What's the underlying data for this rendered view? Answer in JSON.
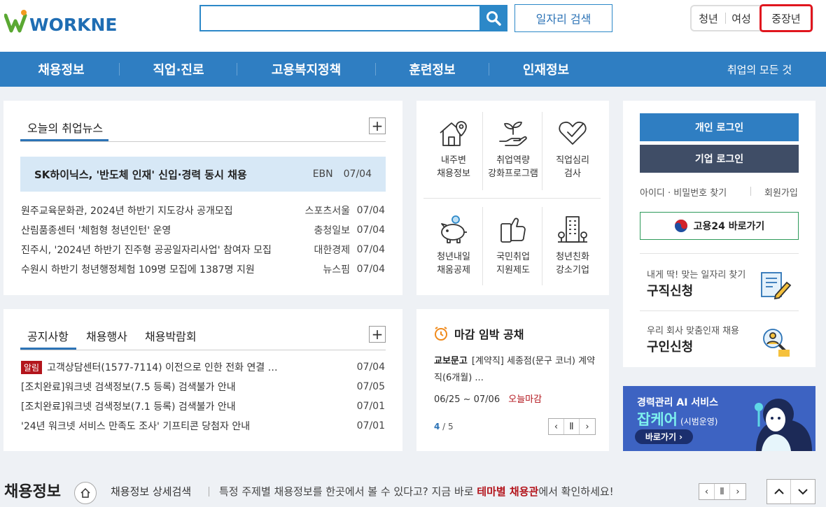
{
  "header": {
    "logo_text": "WORKNET",
    "search": {
      "value": "",
      "placeholder": ""
    },
    "job_search_label": "일자리 검색",
    "group_tabs": [
      "청년",
      "여성",
      "중장년"
    ]
  },
  "nav": {
    "items": [
      "채용정보",
      "직업·진로",
      "고용복지정책",
      "훈련정보",
      "인재정보"
    ],
    "all_label": "취업의 모든 것"
  },
  "news": {
    "tab": "오늘의 취업뉴스",
    "featured": {
      "title": "SK하이닉스, '반도체 인재' 신입·경력 동시 채용",
      "source": "EBN",
      "date": "07/04"
    },
    "items": [
      {
        "title": "원주교육문화관, 2024년 하반기 지도강사 공개모집",
        "source": "스포츠서울",
        "date": "07/04"
      },
      {
        "title": "산림품종센터 '체험형 청년인턴' 운영",
        "source": "충청일보",
        "date": "07/04"
      },
      {
        "title": "진주시, '2024년 하반기 진주형 공공일자리사업' 참여자 모집",
        "source": "대한경제",
        "date": "07/04"
      },
      {
        "title": "수원시 하반기 청년행정체험 109명 모집에 1387명 지원",
        "source": "뉴스핌",
        "date": "07/04"
      }
    ]
  },
  "services": [
    {
      "line1": "내주변",
      "line2": "채용정보",
      "icon": "house-location-icon"
    },
    {
      "line1": "취업역량",
      "line2": "강화프로그램",
      "icon": "hand-sprout-icon"
    },
    {
      "line1": "직업심리",
      "line2": "검사",
      "icon": "heart-check-icon"
    },
    {
      "line1": "청년내일",
      "line2": "채움공제",
      "icon": "piggy-bank-icon"
    },
    {
      "line1": "국민취업",
      "line2": "지원제도",
      "icon": "phone-thumbs-up-icon"
    },
    {
      "line1": "청년친화",
      "line2": "강소기업",
      "icon": "building-icon"
    }
  ],
  "login": {
    "personal": "개인 로그인",
    "company": "기업 로그인",
    "find": "아이디 · 비밀번호 찾기",
    "join": "회원가입",
    "goyong24": "고용24 바로가기"
  },
  "promo": {
    "job_seek_sub": "내게 딱! 맞는 일자리 찾기",
    "job_seek_title": "구직신청",
    "hire_sub": "우리 회사 맞춤인재 채용",
    "hire_title": "구인신청"
  },
  "notices": {
    "tabs": [
      "공지사항",
      "채용행사",
      "채용박람회"
    ],
    "badge": "알림",
    "items": [
      {
        "title": "고객상담센터(1577-7114) 이전으로 인한 전화 연결 …",
        "date": "07/04",
        "badge": true
      },
      {
        "title": "[조치완료]워크넷 검색정보(7.5 등록) 검색불가 안내",
        "date": "07/05",
        "badge": false
      },
      {
        "title": "[조치완료]워크넷 검색정보(7.1 등록) 검색불가 안내",
        "date": "07/01",
        "badge": false
      },
      {
        "title": "'24년 워크넷 서비스 만족도 조사' 기프티콘 당첨자 안내",
        "date": "07/01",
        "badge": false
      }
    ]
  },
  "deadline": {
    "title": "마감 임박 공채",
    "company": "교보문고",
    "desc": "[계약직] 세종점(문구 코너) 계약직(6개월) ...",
    "period": "06/25 ~ 07/06",
    "status": "오늘마감",
    "page_current": "4",
    "page_total": " / 5"
  },
  "banner": {
    "line1": "경력관리 AI 서비스",
    "line2": "잡케어",
    "line2_sub": "(시범운영)",
    "button": "바로가기 ›"
  },
  "bottom": {
    "title": "채용정보",
    "link": "채용정보 상세검색",
    "msg_pre": "특정 주제별 채용정보를 한곳에서 볼 수 있다고? 지금 바로 ",
    "msg_hl": "테마별 채용관",
    "msg_post": "에서 확인하세요!"
  },
  "colors": {
    "primary": "#2f7ec2",
    "dark": "#3f4d66",
    "alert": "#b3151c",
    "highlight": "#e0161e"
  }
}
